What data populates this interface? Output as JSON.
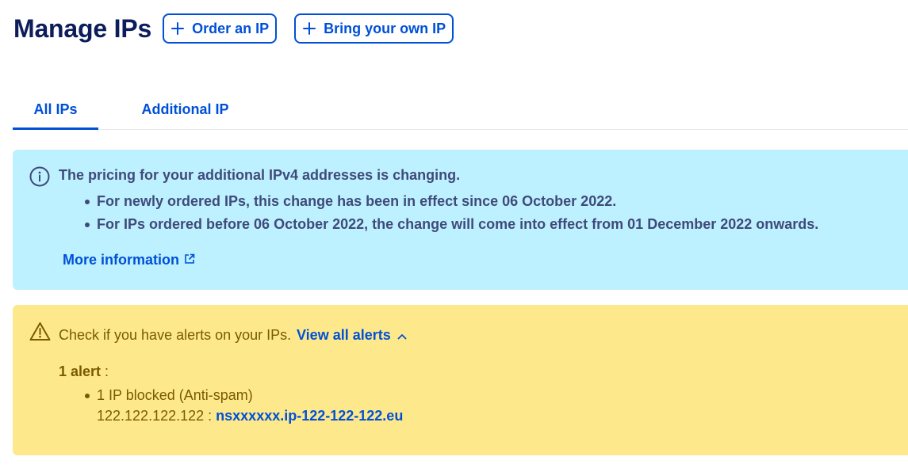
{
  "header": {
    "title": "Manage IPs",
    "order_button": "Order an IP",
    "byoip_button": "Bring your own IP"
  },
  "tabs": [
    {
      "label": "All IPs",
      "active": true
    },
    {
      "label": "Additional IP",
      "active": false
    }
  ],
  "info_banner": {
    "title": "The pricing for your additional IPv4 addresses is changing.",
    "items": [
      "For newly ordered IPs, this change has been in effect since 06 October 2022.",
      "For IPs ordered before 06 October 2022, the change will come into effect from 01 December 2022 onwards."
    ],
    "link": "More information",
    "icon": "info-icon",
    "background": "#bef1ff"
  },
  "warning_banner": {
    "text": "Check if you have alerts on your IPs.",
    "link": "View all alerts",
    "count_label": "1 alert",
    "count_suffix": " :",
    "items": [
      "1 IP blocked (Anti-spam)"
    ],
    "ip": "122.122.122.122",
    "separator": " : ",
    "host": "nsxxxxxx.ip-122-122-122.eu",
    "icon": "warning-icon",
    "background": "#fde98b"
  },
  "colors": {
    "primary": "#0050d7",
    "title": "#0d1d5c",
    "info_text": "#3f4a7a",
    "warning_text": "#7a5a00"
  }
}
